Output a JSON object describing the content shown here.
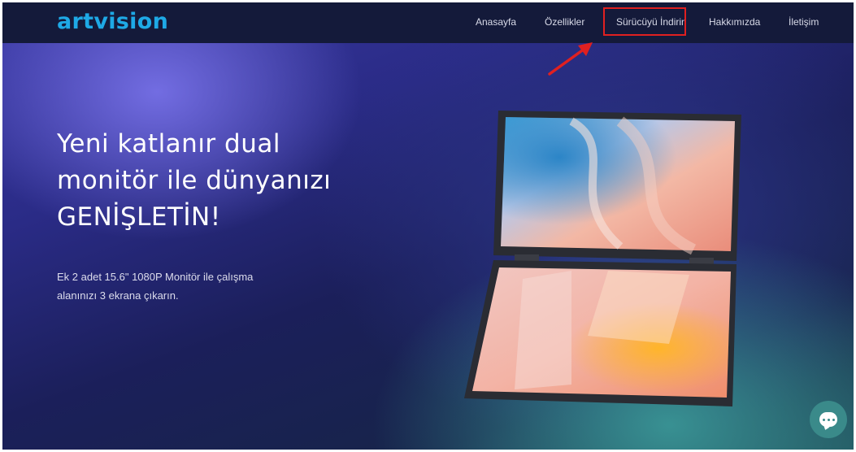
{
  "brand": {
    "logo_text": "artvision",
    "logo_color": "#1ea9e6"
  },
  "nav": {
    "items": [
      {
        "label": "Anasayfa"
      },
      {
        "label": "Özellikler"
      },
      {
        "label": "Sürücüyü İndirin",
        "highlighted": true
      },
      {
        "label": "Hakkımızda"
      },
      {
        "label": "İletişim"
      }
    ]
  },
  "hero": {
    "headline_lines": [
      "Yeni katlanır dual",
      "monitör ile dünyanızı",
      "GENİŞLETİN!"
    ],
    "subtext_lines": [
      "Ek 2 adet 15.6\" 1080P Monitör ile çalışma",
      "alanınızı 3 ekrana çıkarın."
    ]
  },
  "annotation": {
    "highlight_color": "#e02020",
    "arrow_target": "Sürücüyü İndirin"
  },
  "chat": {
    "icon": "chat-bubble-icon"
  }
}
